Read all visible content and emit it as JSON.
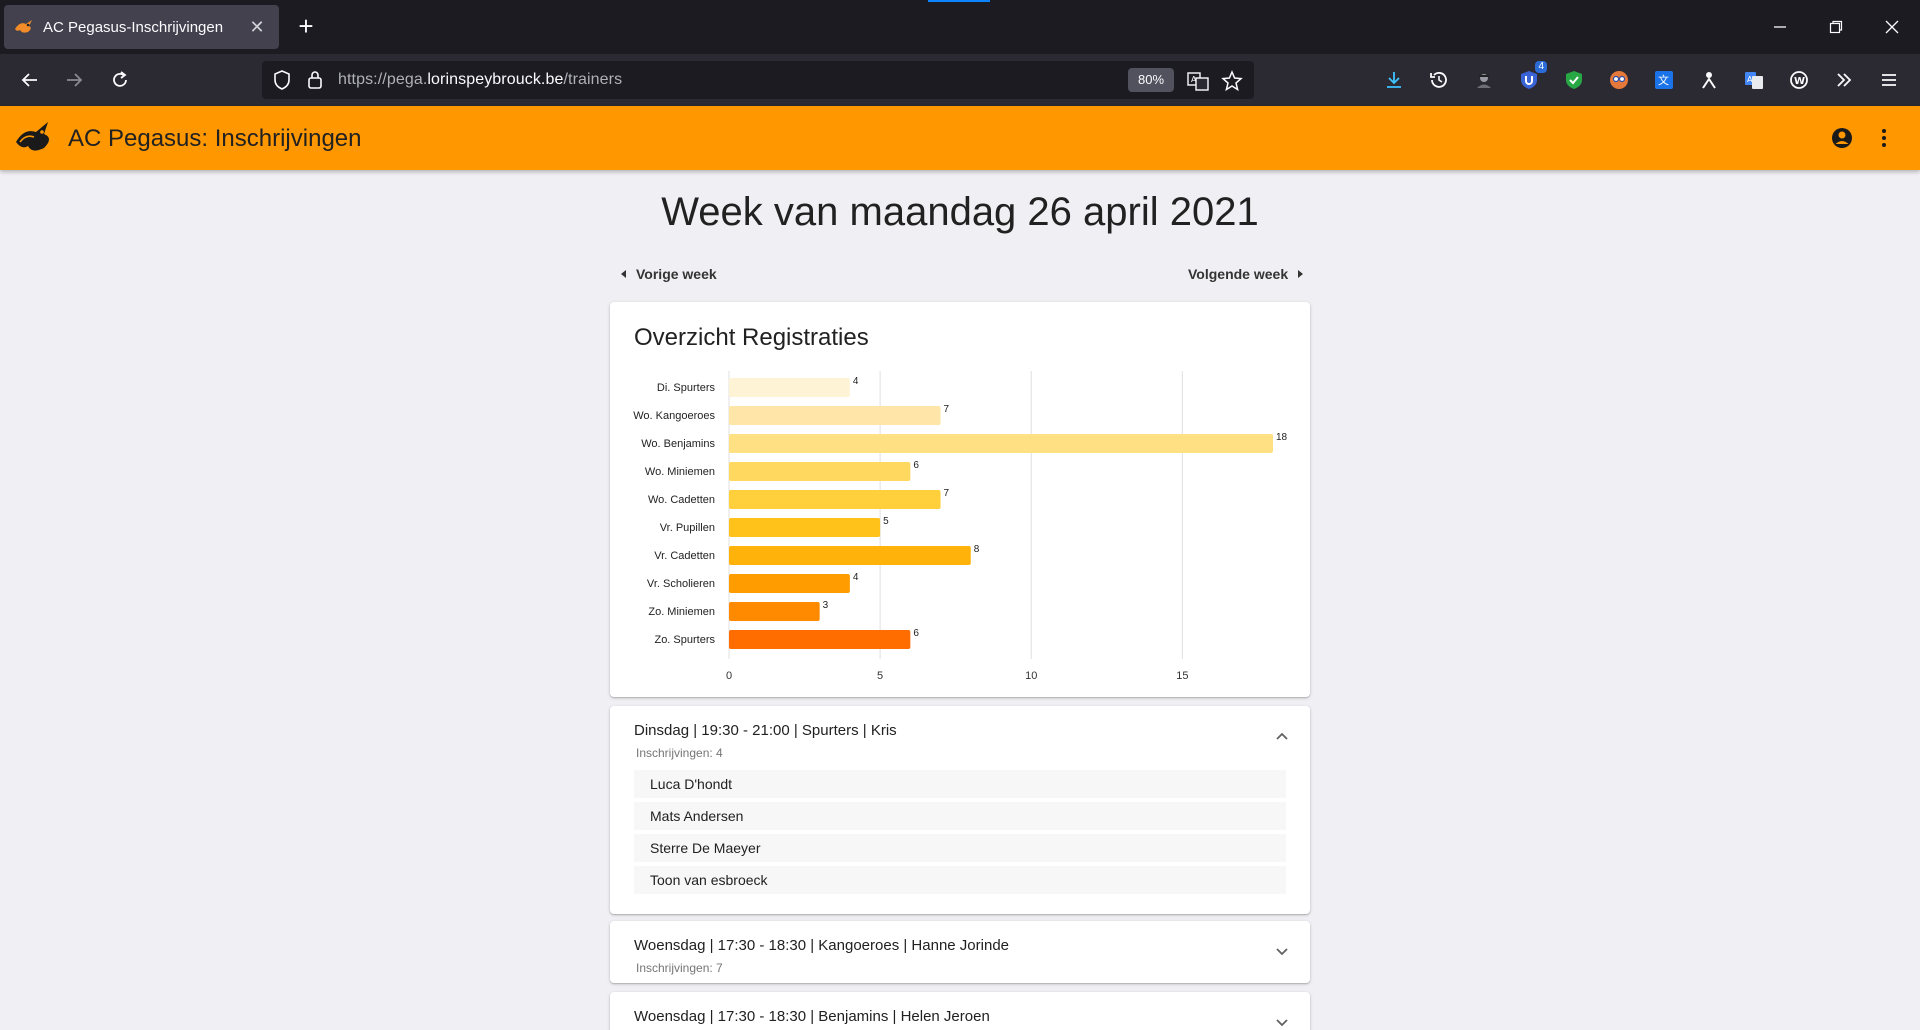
{
  "browser": {
    "tab_title": "AC Pegasus-Inschrijvingen",
    "url_prefix": "https://pega.",
    "url_domain": "lorinspeybrouck.be",
    "url_path": "/trainers",
    "zoom": "80%",
    "extension_badge": "4"
  },
  "app": {
    "title": "AC Pegasus: Inschrijvingen",
    "accent_color": "#ff9800"
  },
  "week": {
    "title": "Week van maandag 26 april 2021",
    "prev_label": "Vorige week",
    "next_label": "Volgende week"
  },
  "chart_card": {
    "heading": "Overzicht Registraties"
  },
  "chart_data": {
    "type": "bar",
    "orientation": "horizontal",
    "categories": [
      "Di. Spurters",
      "Wo. Kangoeroes",
      "Wo. Benjamins",
      "Wo. Miniemen",
      "Wo. Cadetten",
      "Vr. Pupillen",
      "Vr. Cadetten",
      "Vr. Scholieren",
      "Zo. Miniemen",
      "Zo. Spurters"
    ],
    "values": [
      4,
      7,
      18,
      6,
      7,
      5,
      8,
      4,
      3,
      6
    ],
    "colors": [
      "#fff3d6",
      "#ffe6a8",
      "#ffe083",
      "#ffd860",
      "#ffcf3c",
      "#ffc21a",
      "#ffb30a",
      "#ff9c00",
      "#ff8a00",
      "#ff6d00"
    ],
    "xlim": [
      0,
      18
    ],
    "xticks": [
      0,
      5,
      10,
      15
    ],
    "grid": true
  },
  "sessions": [
    {
      "header": "Dinsdag | 19:30 - 21:00 | Spurters | Kris",
      "count_text": "Inschrijvingen: 4",
      "expanded": true,
      "people": [
        "Luca D'hondt",
        "Mats Andersen",
        "Sterre De Maeyer",
        "Toon van esbroeck"
      ]
    },
    {
      "header": "Woensdag | 17:30 - 18:30 | Kangoeroes | Hanne Jorinde",
      "count_text": "Inschrijvingen: 7",
      "expanded": false,
      "people": []
    },
    {
      "header": "Woensdag | 17:30 - 18:30 | Benjamins | Helen Jeroen",
      "count_text": "",
      "expanded": false,
      "people": []
    }
  ]
}
